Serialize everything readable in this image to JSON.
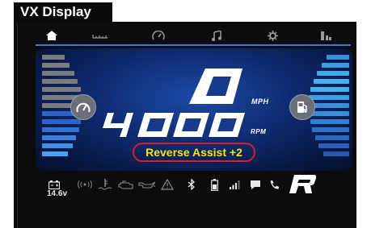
{
  "header": {
    "title": "VX Display"
  },
  "nav": {
    "items": [
      {
        "icon": "home-icon",
        "active": true
      },
      {
        "icon": "ruler-icon",
        "active": false
      },
      {
        "icon": "speedometer-icon",
        "active": false
      },
      {
        "icon": "music-icon",
        "active": false
      },
      {
        "icon": "gear-icon",
        "active": false
      },
      {
        "icon": "trim-icon",
        "active": false
      }
    ]
  },
  "dashboard": {
    "speed": {
      "value": "0",
      "unit": "MPH"
    },
    "rpm": {
      "value": "4000",
      "unit": "RPM"
    },
    "assist_message": "Reverse Assist +2",
    "left_button_icon": "gauge-icon",
    "right_button_icon": "fuel-icon"
  },
  "status": {
    "voltage": "14.6v",
    "icons": [
      "battery-icon",
      "signal-icon",
      "temperature-icon",
      "engine-icon",
      "oil-icon",
      "warning-icon",
      "bluetooth-icon",
      "phone-battery-icon",
      "cell-signal-icon",
      "message-icon",
      "phone-icon"
    ],
    "gear": "R"
  },
  "colors": {
    "accent_blue": "#3a78d8",
    "assist_border": "#d61f26",
    "assist_text": "#ffe400",
    "screen_bg": "#0e2b70"
  }
}
